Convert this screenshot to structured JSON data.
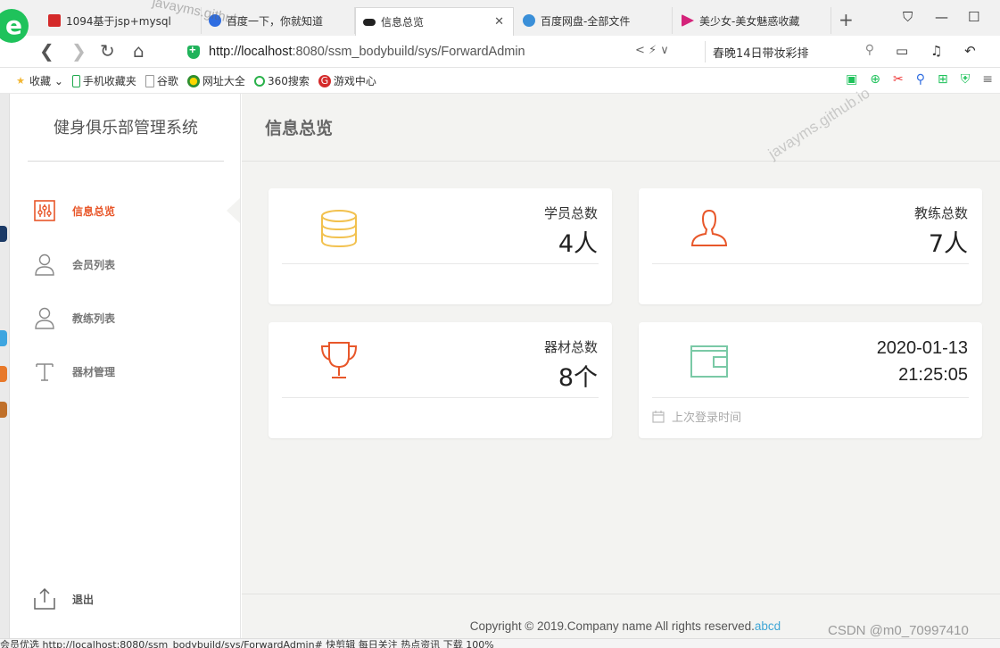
{
  "browser": {
    "tabs": [
      {
        "label": "1094基于jsp+mysql",
        "active": false,
        "color": "#d42a2a"
      },
      {
        "label": "百度一下，你就知道",
        "active": false,
        "color": "#2f6de1"
      },
      {
        "label": "信息总览",
        "active": true,
        "color": "#222222"
      },
      {
        "label": "百度网盘-全部文件",
        "active": false,
        "color": "#3a8fd8"
      },
      {
        "label": "美少女-美女魅惑收藏",
        "active": false,
        "color": "#d4237a"
      }
    ],
    "close_glyph": "✕",
    "new_tab_glyph": "+",
    "url_host": "http://localhost",
    "url_rest": ":8080/ssm_bodybuild/sys/ForwardAdmin",
    "search_text": "春晚14日带妆彩排",
    "bookmarks": [
      "收藏",
      "手机收藏夹",
      "谷歌",
      "网址大全",
      "360搜索",
      "游戏中心"
    ],
    "status_text": "会员优选  http://localhost:8080/ssm_bodybuild/sys/ForwardAdmin#                                  快剪辑    每日关注    热点资讯           下载            100%"
  },
  "sidebar": {
    "brand": "健身俱乐部管理系统",
    "items": [
      {
        "label": "信息总览",
        "icon": "sliders-icon",
        "active": true
      },
      {
        "label": "会员列表",
        "icon": "user-icon",
        "active": false
      },
      {
        "label": "教练列表",
        "icon": "user-icon",
        "active": false
      },
      {
        "label": "器材管理",
        "icon": "text-t-icon",
        "active": false
      }
    ],
    "logout_label": "退出"
  },
  "main": {
    "title": "信息总览",
    "cards": {
      "members": {
        "label": "学员总数",
        "value": "4人",
        "icon": "database-icon",
        "color": "#f2c14e"
      },
      "coaches": {
        "label": "教练总数",
        "value": "7人",
        "icon": "user-icon",
        "color": "#e8572a"
      },
      "equipment": {
        "label": "器材总数",
        "value": "8个",
        "icon": "trophy-icon",
        "color": "#e8572a"
      },
      "login": {
        "date": "2020-01-13",
        "time": "21:25:05",
        "foot": "上次登录时间",
        "icon": "wallet-icon",
        "color": "#7ac9a6"
      }
    },
    "footer_text": "Copyright © 2019.Company name All rights reserved.",
    "footer_link": "abcd"
  },
  "watermarks": {
    "w1": "javayms.github.io",
    "w2": "javayms.github",
    "csdn": "CSDN @m0_70997410"
  },
  "colors": {
    "accent": "#e8572a",
    "content_bg": "#f3f3f1",
    "link": "#3fa6d6"
  }
}
